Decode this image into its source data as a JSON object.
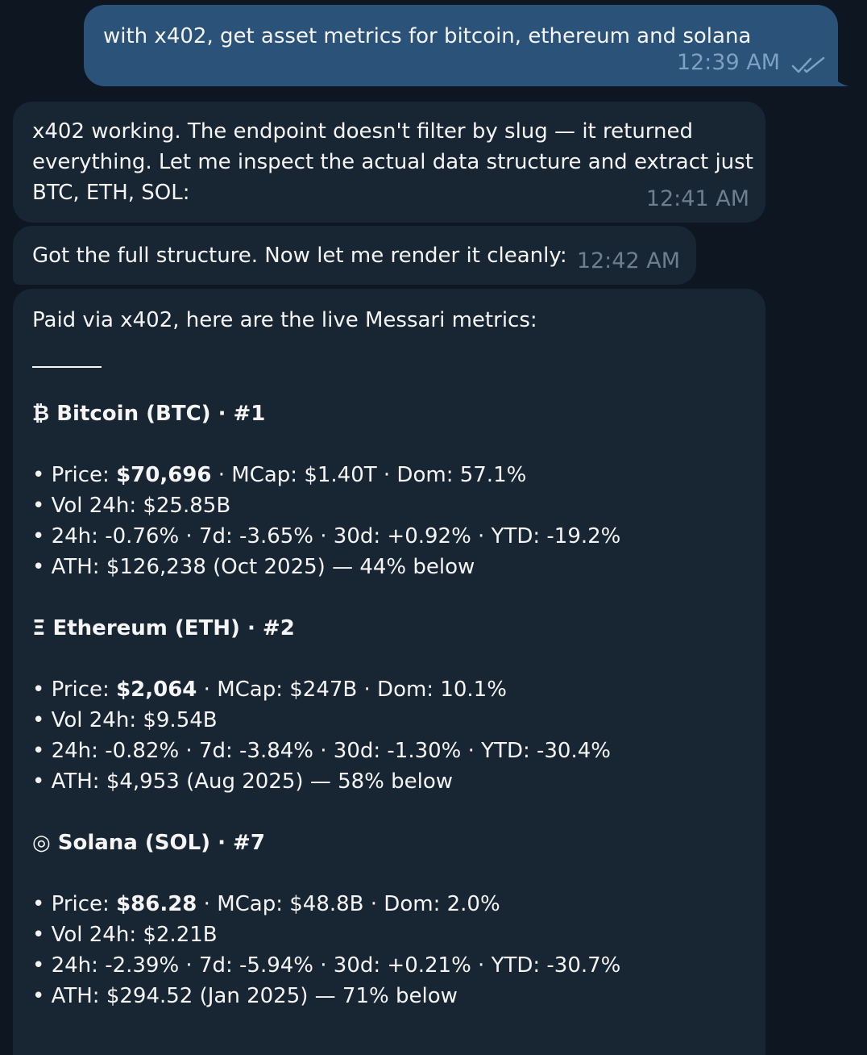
{
  "outgoing": {
    "text": "with x402, get asset metrics for bitcoin, ethereum and solana",
    "time": "12:39 AM",
    "status_icon": "double-check-icon"
  },
  "incoming": [
    {
      "lines": [
        "x402 working. The endpoint doesn't filter by slug — it returned",
        "everything. Let me inspect the actual data structure and extract just",
        "BTC, ETH, SOL:"
      ],
      "time": "12:41 AM"
    },
    {
      "text": "Got the full structure. Now let me render it cleanly:",
      "time": "12:42 AM"
    }
  ],
  "report": {
    "intro": "Paid via x402, here are the live Messari metrics:",
    "assets": [
      {
        "title": "₿ Bitcoin (BTC) · #1",
        "price_label": "• Price: ",
        "price": "$70,696",
        "price_rest": " · MCap: $1.40T · Dom: 57.1%",
        "volume": "• Vol 24h: $25.85B",
        "changes": "• 24h: -0.76% · 7d: -3.65% · 30d: +0.92% · YTD: -19.2%",
        "ath": "• ATH: $126,238 (Oct 2025) — 44% below"
      },
      {
        "title": "Ξ Ethereum (ETH) · #2",
        "price_label": "• Price: ",
        "price": "$2,064",
        "price_rest": " · MCap: $247B · Dom: 10.1%",
        "volume": "• Vol 24h: $9.54B",
        "changes": "• 24h: -0.82% · 7d: -3.84% · 30d: -1.30% · YTD: -30.4%",
        "ath": "• ATH: $4,953 (Aug 2025) — 58% below"
      },
      {
        "title": "◎ Solana (SOL) · #7",
        "price_label": "• Price: ",
        "price": "$86.28",
        "price_rest": " · MCap: $48.8B · Dom: 2.0%",
        "volume": "• Vol 24h: $2.21B",
        "changes": "• 24h: -2.39% · 7d: -5.94% · 30d: +0.21% · YTD: -30.7%",
        "ath": "• ATH: $294.52 (Jan 2025) — 71% below"
      }
    ]
  },
  "colors": {
    "background": "#0e1621",
    "outgoing_bubble": "#2b5278",
    "incoming_bubble": "#182533",
    "text": "#f5f5f5",
    "outgoing_time": "#7ea0c2",
    "incoming_time": "#6d7f8f"
  }
}
